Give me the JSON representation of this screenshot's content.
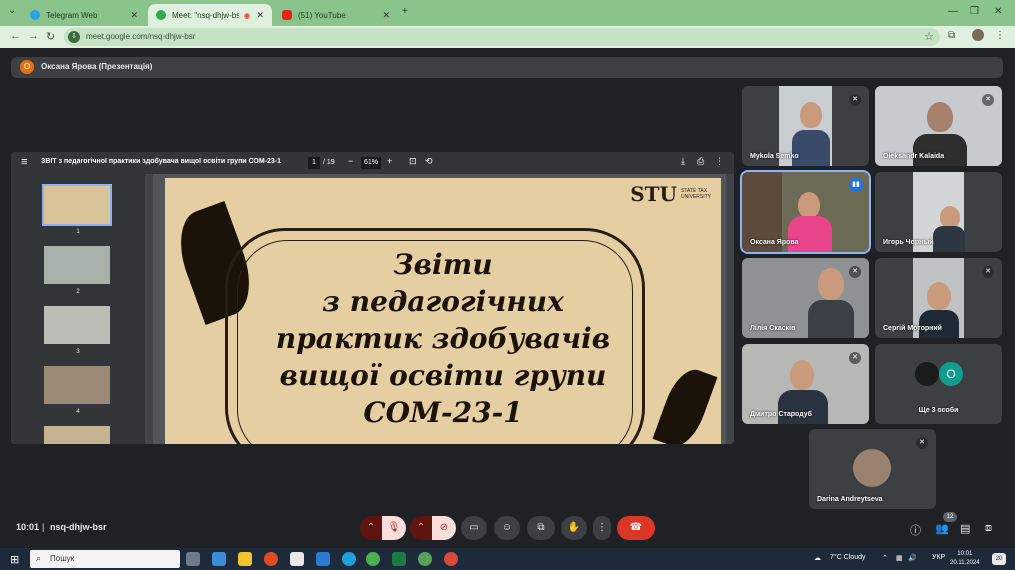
{
  "browser": {
    "tabs": [
      {
        "label": "Telegram Web",
        "icon": "telegram-icon",
        "color": "#2aa3df"
      },
      {
        "label": "Meet: \"nsq-dhjw-bsr\"",
        "icon": "meet-icon",
        "color": "#34a853"
      },
      {
        "label": "(51) YouTube",
        "icon": "youtube-icon",
        "color": "#e62117"
      }
    ],
    "url": "meet.google.com/nsq-dhjw-bsr"
  },
  "meet": {
    "presenter_initial": "О",
    "presenter_label": "Оксана Ярова (Презентація)",
    "pdf": {
      "title": "ЗВІТ з педагогічної практики здобувача вищої освіти групи СОМ-23-1",
      "page": "1",
      "page_total": "/ 19",
      "zoom": "61%",
      "thumbnails": [
        "1",
        "2",
        "3",
        "4"
      ],
      "slide_lines": [
        "Звіти",
        "з педагогічних",
        "практик здобувачів",
        "вищої освіти групи",
        "СОМ-23-1"
      ],
      "logo": "STU",
      "logo_sub": "STATE TAX UNIVERSITY"
    },
    "participants": [
      {
        "name": "Mykola Semko",
        "muted": true
      },
      {
        "name": "Oleksandr Kalaida",
        "muted": true
      },
      {
        "name": "Оксана Ярова",
        "speaking": true
      },
      {
        "name": "Игорь Чорный",
        "muted": false
      },
      {
        "name": "Лілія Скаскiв",
        "muted": true
      },
      {
        "name": "Сергій Моторний",
        "muted": true
      },
      {
        "name": "Дмитро Стародуб",
        "muted": true
      },
      {
        "name": "Ще 3 особи",
        "initial": "O"
      },
      {
        "name": "Darina Andreytseva",
        "muted": true
      }
    ],
    "time": "10:01",
    "separator": "|",
    "meeting_code": "nsq-dhjw-bsr",
    "participant_count": "12"
  },
  "taskbar": {
    "search_placeholder": "Пошук",
    "weather": "7°C Cloudy",
    "lang": "УКР",
    "time": "10:01",
    "date": "20.11.2024",
    "notifications": "20"
  }
}
